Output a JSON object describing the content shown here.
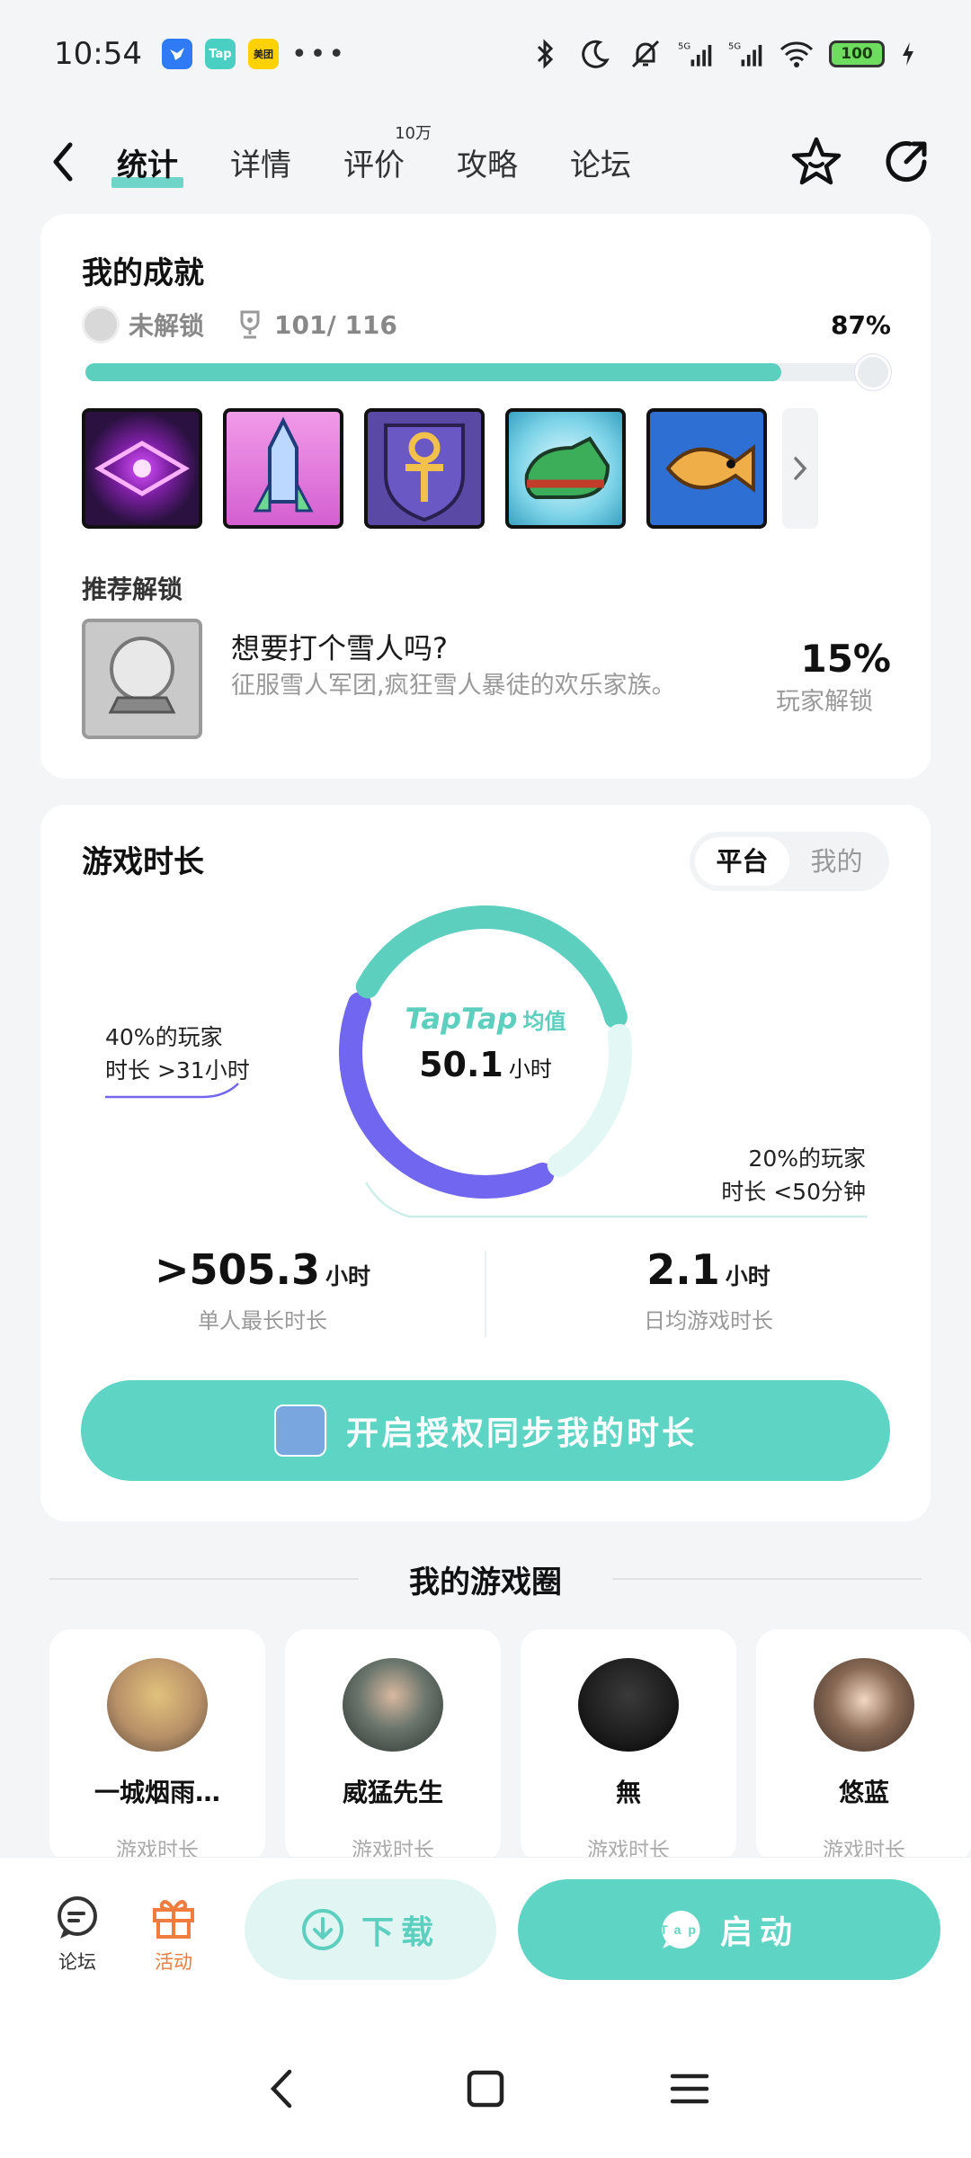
{
  "status_bar": {
    "time": "10:54",
    "apps": [
      {
        "name": "taptap-bird-icon",
        "color": "#2f7bf5"
      },
      {
        "name": "tap-app-icon",
        "color": "#49d0c2",
        "label": "Tap"
      },
      {
        "name": "meituan-icon",
        "color": "#ffd100",
        "label": "美团"
      }
    ],
    "more": "•••",
    "battery": "100"
  },
  "nav": {
    "tabs": [
      {
        "label": "统计",
        "active": true
      },
      {
        "label": "详情"
      },
      {
        "label": "评价",
        "sup": "10万"
      },
      {
        "label": "攻略"
      },
      {
        "label": "论坛"
      }
    ]
  },
  "achievements": {
    "title": "我的成就",
    "locked_label": "未解锁",
    "count": "101/ 116",
    "percent_text": "87%",
    "progress": 0.87,
    "recommend_label": "推荐解锁",
    "recommend": {
      "title": "想要打个雪人吗?",
      "desc": "征服雪人军团,疯狂雪人暴徒的欢乐家族。",
      "percent": "15%",
      "percent_label": "玩家解锁"
    }
  },
  "play_time": {
    "title": "游戏时长",
    "segment": [
      "平台",
      "我的"
    ],
    "brand": "TapTap",
    "brand_suffix": "均值",
    "avg_value": "50.1",
    "avg_unit": "小时",
    "left_callout": [
      "40%的玩家",
      "时长 >31小时"
    ],
    "right_callout": [
      "20%的玩家",
      "时长 <50分钟"
    ],
    "stats": [
      {
        "value": ">505.3",
        "unit": "小时",
        "label": "单人最长时长"
      },
      {
        "value": "2.1",
        "unit": "小时",
        "label": "日均游戏时长"
      }
    ],
    "sync_button": "开启授权同步我的时长",
    "donut": {
      "purple": 0.4,
      "teal": 0.4,
      "light": 0.2,
      "colors": [
        "#7066ef",
        "#5ccfbf",
        "#e3f7f4"
      ]
    }
  },
  "game_circle": {
    "title": "我的游戏圈",
    "friends": [
      {
        "name": "一城烟雨…",
        "label": "游戏时长",
        "color": "#b89168"
      },
      {
        "name": "威猛先生",
        "label": "游戏时长",
        "color": "#4d5d54"
      },
      {
        "name": "無",
        "label": "游戏时长",
        "color": "#1c1c1c"
      },
      {
        "name": "悠蓝",
        "label": "游戏时长",
        "color": "#6f5a4c"
      }
    ]
  },
  "action_bar": {
    "forum": "论坛",
    "activity": "活动",
    "download": "下载",
    "launch": "启动"
  }
}
